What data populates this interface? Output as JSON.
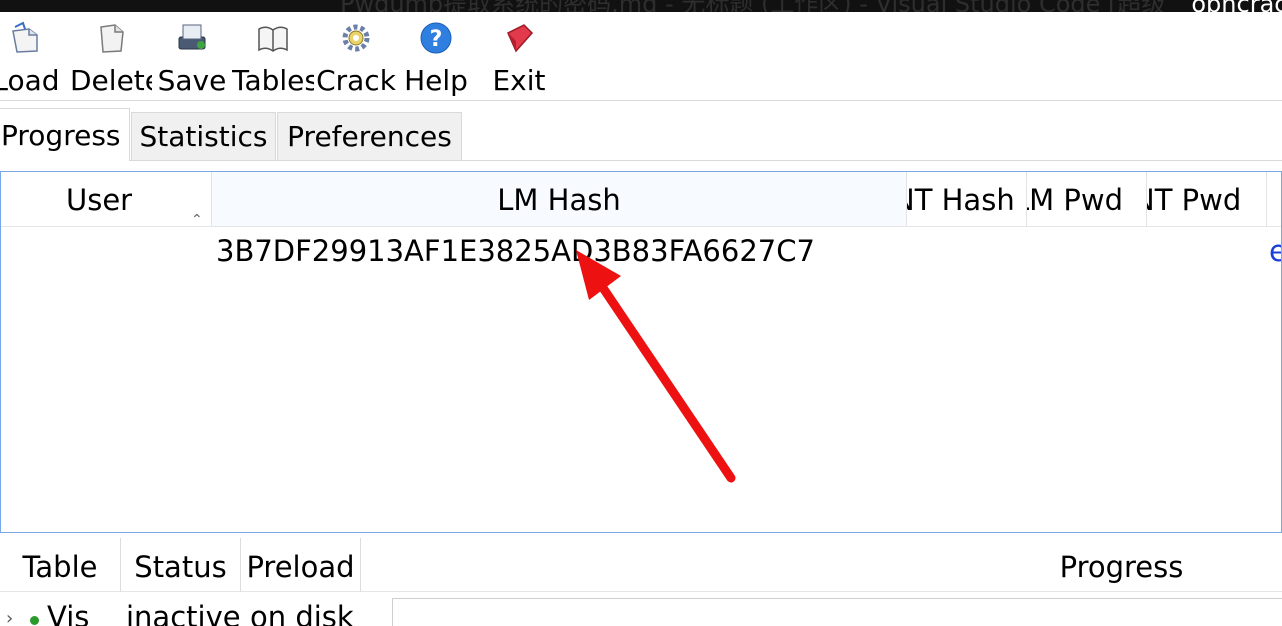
{
  "window": {
    "title_left": "Pwdump提取系统的密码.md - 无标题 (工作区) - Visual Studio Code [超级",
    "title_app": "ophcrack"
  },
  "toolbar": {
    "load": "Load",
    "delete": "Delete",
    "save": "Save",
    "tables": "Tables",
    "crack": "Crack",
    "help": "Help",
    "exit": "Exit"
  },
  "tabs": [
    "Progress",
    "Statistics",
    "Preferences"
  ],
  "grid": {
    "columns": [
      "User",
      "LM Hash",
      "NT Hash",
      "LM Pwd",
      "NT Pwd"
    ],
    "rows": [
      {
        "user": "",
        "lm_hash": "3B7DF29913AF1E3825AD3B83FA6627C7",
        "right_fragment": "e"
      }
    ]
  },
  "tables_panel": {
    "columns": [
      "Table",
      "Status",
      "Preload",
      "Progress"
    ],
    "rows": [
      {
        "table": "Vis",
        "status": "inactive",
        "preload": "on disk"
      }
    ]
  },
  "colors": {
    "accent_border": "#7aa7e6",
    "annotation_arrow": "#ee1111",
    "link_blue": "#1a3fd6"
  }
}
